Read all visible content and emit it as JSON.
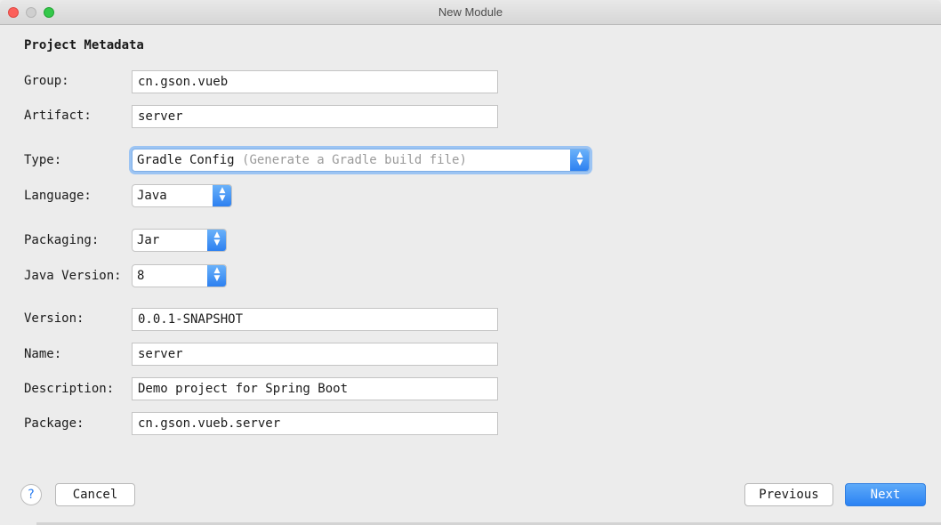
{
  "window": {
    "title": "New Module"
  },
  "section": {
    "title": "Project Metadata"
  },
  "form": {
    "group": {
      "label": "Group:",
      "value": "cn.gson.vueb"
    },
    "artifact": {
      "label": "Artifact:",
      "value": "server"
    },
    "type": {
      "label": "Type:",
      "value": "Gradle Config",
      "hint": "(Generate a Gradle build file)"
    },
    "language": {
      "label": "Language:",
      "value": "Java"
    },
    "packaging": {
      "label": "Packaging:",
      "value": "Jar"
    },
    "java_version": {
      "label": "Java Version:",
      "value": "8"
    },
    "version": {
      "label": "Version:",
      "value": "0.0.1-SNAPSHOT"
    },
    "name": {
      "label": "Name:",
      "value": "server"
    },
    "description": {
      "label": "Description:",
      "value": "Demo project for Spring Boot"
    },
    "package": {
      "label": "Package:",
      "value": "cn.gson.vueb.server"
    }
  },
  "footer": {
    "help": "?",
    "cancel_label": "Cancel",
    "previous_label": "Previous",
    "next_label": "Next"
  },
  "colors": {
    "accent": "#2b82f3",
    "close": "#fc605b",
    "maximize": "#34c84a"
  },
  "icons": {
    "select_arrow": "up-down-chevron-icon",
    "help": "question-mark-icon"
  }
}
